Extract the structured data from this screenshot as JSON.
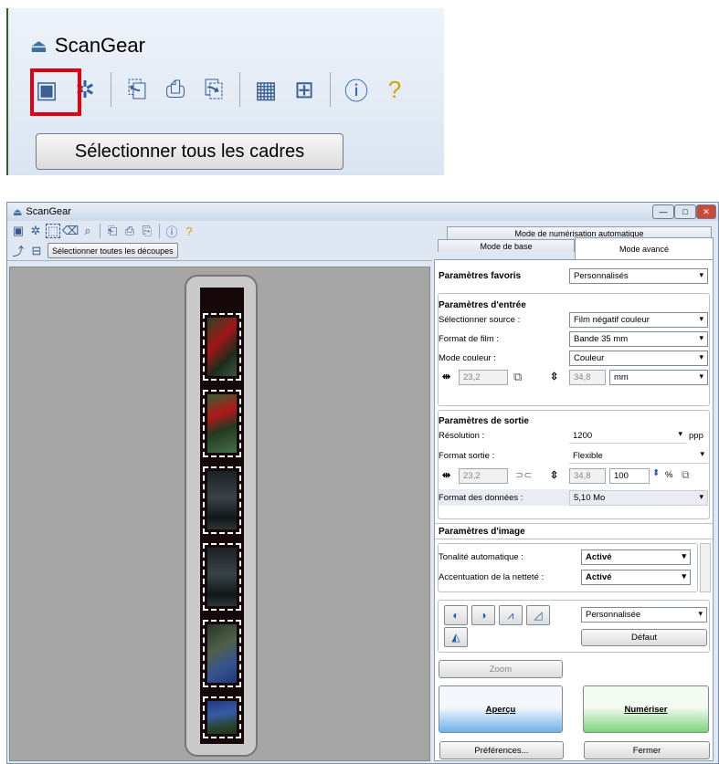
{
  "zoomed": {
    "app_title": "ScanGear",
    "select_all_frames_label": "Sélectionner tous les cadres",
    "toolbar_icons": [
      "select-frames-icon",
      "thumbnail-icon",
      "rotate-left-icon",
      "rotate-icon",
      "rotate-right-icon",
      "multi-crop-icon",
      "grid-icon",
      "info-icon",
      "help-icon"
    ]
  },
  "window": {
    "title": "ScanGear",
    "controls": {
      "min": "—",
      "max": "□",
      "close": "✕"
    },
    "left_toolbar_icons": [
      "select-frames-icon",
      "thumbnail-icon",
      "crop-icon",
      "eraser-icon",
      "zoom-icon",
      "rotate-left-icon",
      "rotate-icon",
      "rotate-right-icon",
      "info-icon",
      "help-icon"
    ],
    "select_all_crops_label": "Sélectionner toutes les découpes"
  },
  "tabs": {
    "auto_mode": "Mode de numérisation automatique",
    "basic_mode": "Mode de base",
    "advanced_mode": "Mode avancé"
  },
  "favorites": {
    "label": "Paramètres favoris",
    "value": "Personnalisés"
  },
  "input": {
    "heading": "Paramètres d'entrée",
    "source_label": "Sélectionner source :",
    "source_value": "Film négatif couleur",
    "film_format_label": "Format de film :",
    "film_format_value": "Bande 35 mm",
    "color_mode_label": "Mode couleur :",
    "color_mode_value": "Couleur",
    "width": "23,2",
    "height": "34,8",
    "unit": "mm"
  },
  "output": {
    "heading": "Paramètres de sortie",
    "resolution_label": "Résolution :",
    "resolution_value": "1200",
    "resolution_unit": "ppp",
    "output_size_label": "Format sortie :",
    "output_size_value": "Flexible",
    "width": "23,2",
    "height": "34,8",
    "scale": "100",
    "percent": "%",
    "data_size_label": "Format des données :",
    "data_size_value": "5,10 Mo"
  },
  "image_settings": {
    "heading": "Paramètres d'image",
    "auto_tone_label": "Tonalité automatique :",
    "auto_tone_value": "Activé",
    "sharpen_label": "Accentuation de la netteté :",
    "sharpen_value": "Activé"
  },
  "adjust": {
    "preset_value": "Personnalisée",
    "default_label": "Défaut"
  },
  "actions": {
    "zoom": "Zoom",
    "preview": "Aperçu",
    "scan": "Numériser",
    "preferences": "Préférences...",
    "close": "Fermer"
  },
  "colors": {
    "highlight": "#e00010",
    "preview_button": "#6fb0ea",
    "scan_button": "#7ed37a"
  }
}
